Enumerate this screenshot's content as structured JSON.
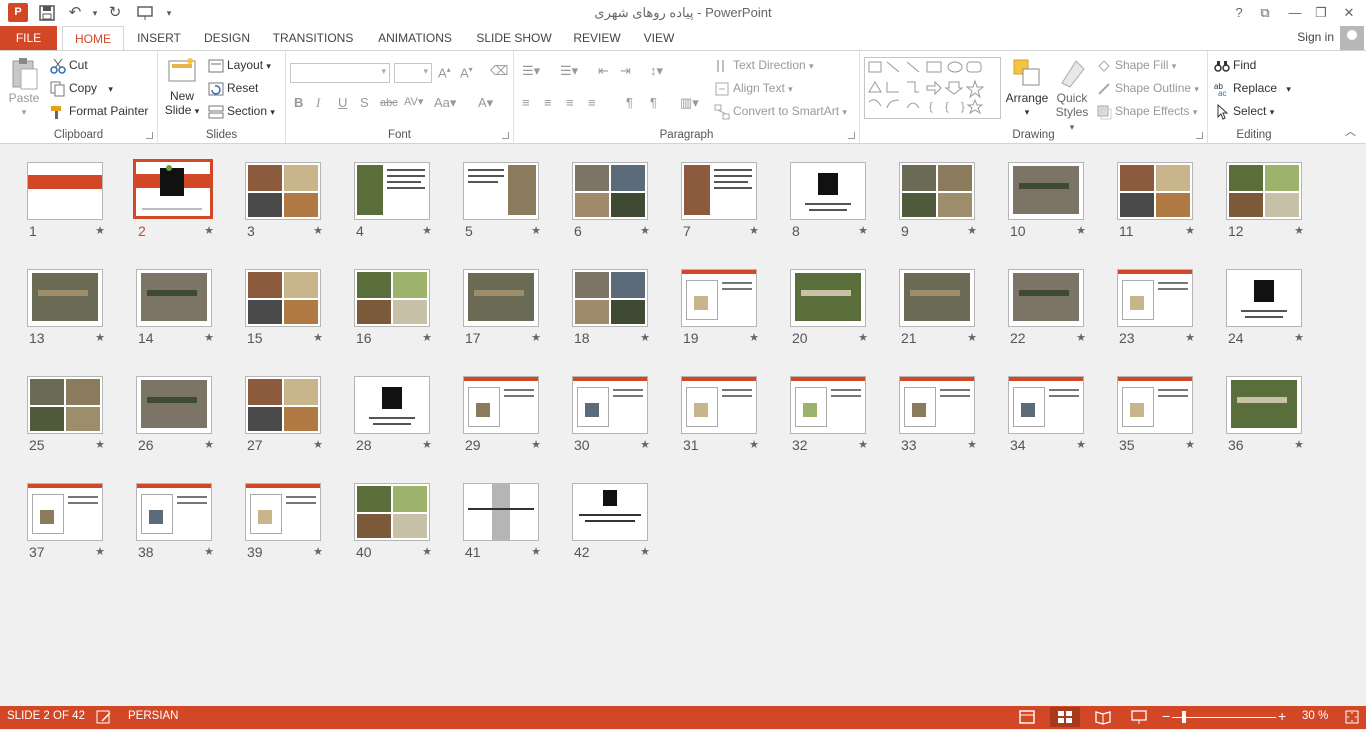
{
  "window": {
    "title": "پیاده روهای شهری - PowerPoint",
    "help": "?",
    "qat": {
      "app_icon": "P",
      "save_icon": "save-icon",
      "undo_icon": "undo-icon",
      "redo_icon": "redo-icon",
      "present_icon": "present-icon"
    }
  },
  "tabs": {
    "file": "FILE",
    "items": [
      "HOME",
      "INSERT",
      "DESIGN",
      "TRANSITIONS",
      "ANIMATIONS",
      "SLIDE SHOW",
      "REVIEW",
      "VIEW"
    ],
    "active": "HOME",
    "signin": "Sign in"
  },
  "ribbon": {
    "clipboard": {
      "label": "Clipboard",
      "paste": "Paste",
      "cut": "Cut",
      "copy": "Copy",
      "format_painter": "Format Painter"
    },
    "slides": {
      "label": "Slides",
      "new_slide_1": "New",
      "new_slide_2": "Slide",
      "layout": "Layout",
      "reset": "Reset",
      "section": "Section"
    },
    "font": {
      "label": "Font",
      "font_name": "",
      "font_size": ""
    },
    "paragraph": {
      "label": "Paragraph",
      "text_direction": "Text Direction",
      "align_text": "Align Text",
      "convert_smartart": "Convert to SmartArt"
    },
    "drawing": {
      "label": "Drawing",
      "arrange": "Arrange",
      "quick_styles_1": "Quick",
      "quick_styles_2": "Styles",
      "shape_fill": "Shape Fill",
      "shape_outline": "Shape Outline",
      "shape_effects": "Shape Effects"
    },
    "editing": {
      "label": "Editing",
      "find": "Find",
      "replace": "Replace",
      "select": "Select"
    }
  },
  "slides": [
    {
      "n": "1",
      "star": "★",
      "style": "title"
    },
    {
      "n": "2",
      "star": "★",
      "style": "title-logo",
      "selected": true
    },
    {
      "n": "3",
      "star": "★",
      "style": "photos"
    },
    {
      "n": "4",
      "star": "★",
      "style": "photo-text"
    },
    {
      "n": "5",
      "star": "★",
      "style": "text-photo"
    },
    {
      "n": "6",
      "star": "★",
      "style": "photos"
    },
    {
      "n": "7",
      "star": "★",
      "style": "photo-text"
    },
    {
      "n": "8",
      "star": "★",
      "style": "logo"
    },
    {
      "n": "9",
      "star": "★",
      "style": "photos"
    },
    {
      "n": "10",
      "star": "★",
      "style": "photo"
    },
    {
      "n": "11",
      "star": "★",
      "style": "photos"
    },
    {
      "n": "12",
      "star": "★",
      "style": "photos"
    },
    {
      "n": "13",
      "star": "★",
      "style": "photo"
    },
    {
      "n": "14",
      "star": "★",
      "style": "photo"
    },
    {
      "n": "15",
      "star": "★",
      "style": "photos"
    },
    {
      "n": "16",
      "star": "★",
      "style": "photos"
    },
    {
      "n": "17",
      "star": "★",
      "style": "photo"
    },
    {
      "n": "18",
      "star": "★",
      "style": "photos"
    },
    {
      "n": "19",
      "star": "★",
      "style": "diagram"
    },
    {
      "n": "20",
      "star": "★",
      "style": "photo"
    },
    {
      "n": "21",
      "star": "★",
      "style": "photo"
    },
    {
      "n": "22",
      "star": "★",
      "style": "photo"
    },
    {
      "n": "23",
      "star": "★",
      "style": "diagram"
    },
    {
      "n": "24",
      "star": "★",
      "style": "logo"
    },
    {
      "n": "25",
      "star": "★",
      "style": "photos"
    },
    {
      "n": "26",
      "star": "★",
      "style": "photo"
    },
    {
      "n": "27",
      "star": "★",
      "style": "photos"
    },
    {
      "n": "28",
      "star": "★",
      "style": "logo"
    },
    {
      "n": "29",
      "star": "★",
      "style": "diagram"
    },
    {
      "n": "30",
      "star": "★",
      "style": "diagram"
    },
    {
      "n": "31",
      "star": "★",
      "style": "diagram"
    },
    {
      "n": "32",
      "star": "★",
      "style": "diagram"
    },
    {
      "n": "33",
      "star": "★",
      "style": "diagram"
    },
    {
      "n": "34",
      "star": "★",
      "style": "diagram"
    },
    {
      "n": "35",
      "star": "★",
      "style": "diagram"
    },
    {
      "n": "36",
      "star": "★",
      "style": "photo"
    },
    {
      "n": "37",
      "star": "★",
      "style": "diagram"
    },
    {
      "n": "38",
      "star": "★",
      "style": "diagram"
    },
    {
      "n": "39",
      "star": "★",
      "style": "diagram"
    },
    {
      "n": "40",
      "star": "★",
      "style": "photos"
    },
    {
      "n": "41",
      "star": "★",
      "style": "text"
    },
    {
      "n": "42",
      "star": "★",
      "style": "logo-text"
    }
  ],
  "status": {
    "slide_info": "SLIDE 2 OF 42",
    "language": "PERSIAN",
    "zoom_minus": "−",
    "zoom_plus": "+",
    "zoom": "30 %",
    "zoom_level_percent": 30
  },
  "colors": {
    "accent": "#d24726",
    "thumb_border": "#b5b5b5"
  }
}
